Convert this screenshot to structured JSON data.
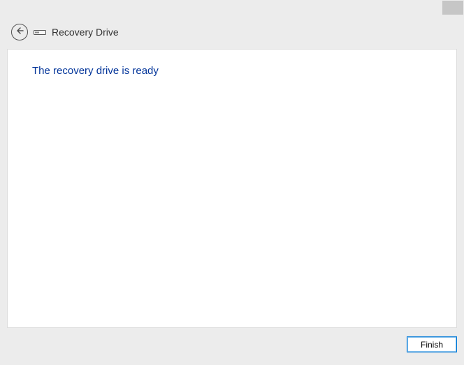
{
  "window": {
    "close_label": "×"
  },
  "header": {
    "title": "Recovery Drive"
  },
  "content": {
    "heading": "The recovery drive is ready"
  },
  "footer": {
    "finish_label": "Finish"
  }
}
